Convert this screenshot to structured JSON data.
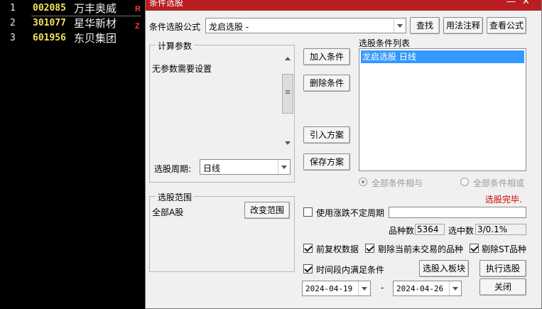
{
  "stock_list": [
    {
      "index": "1",
      "code": "002085",
      "name": "万丰奥威",
      "tag": "R"
    },
    {
      "index": "2",
      "code": "301077",
      "name": "星华新材",
      "tag": "Z"
    },
    {
      "index": "3",
      "code": "601956",
      "name": "东贝集团",
      "tag": ""
    }
  ],
  "dialog": {
    "title": "条件选股",
    "formula_label": "条件选股公式",
    "formula_value": "龙启选股      -",
    "find_button": "查找",
    "usage_button": "用法注释",
    "view_formula_button": "查看公式",
    "params_group": "计算参数",
    "params_text": "无参数需要设置",
    "period_label": "选股周期:",
    "period_value": "日线",
    "add_condition": "加入条件",
    "delete_condition": "删除条件",
    "import_plan": "引入方案",
    "save_plan": "保存方案",
    "conditions_list_label": "选股条件列表",
    "conditions": [
      "龙启选股  日线"
    ],
    "all_and": "全部条件相与",
    "all_or": "全部条件相或",
    "status_text": "选股完毕.",
    "range_group": "选股范围",
    "range_value": "全部A股",
    "change_range": "改变范围",
    "use_limit_period": "使用涨跌不定周期",
    "variety_count_label": "品种数",
    "variety_count": "5364",
    "selected_label": "选中数",
    "selected_value": "3/0.1%",
    "prior_adjust": "前复权数据",
    "exclude_untraded": "剔除当前未交易的品种",
    "exclude_st": "剔除ST品种",
    "time_range_label": "时间段内满足条件",
    "to_block": "选股入板块",
    "execute": "执行选股",
    "date_from": "2024-04-19",
    "date_sep": "-",
    "date_to": "2024-04-26",
    "close": "关闭"
  },
  "colors": {
    "title_bar": "#b81e22",
    "status": "#d00000",
    "selection": "#3399ff",
    "stock_code": "#f2e35a"
  }
}
